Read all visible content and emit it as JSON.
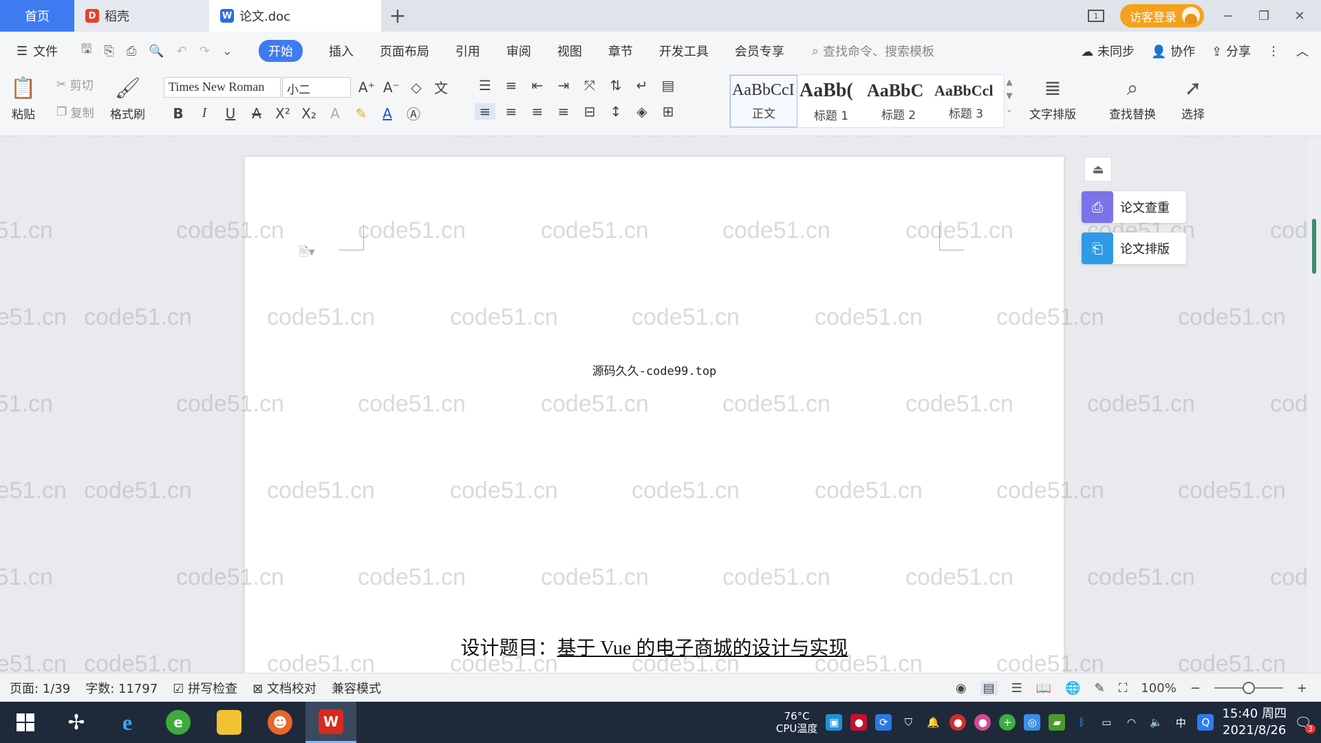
{
  "tabs": {
    "home": "首页",
    "docer": "稻壳",
    "doc": "论文.doc",
    "add": "+"
  },
  "titlebar": {
    "login": "访客登录",
    "win_box": "1",
    "minimize": "−",
    "restore": "❐",
    "close": "✕"
  },
  "menu": {
    "file": "文件",
    "items": [
      "开始",
      "插入",
      "页面布局",
      "引用",
      "审阅",
      "视图",
      "章节",
      "开发工具",
      "会员专享"
    ],
    "search": "查找命令、搜索模板",
    "unsync": "未同步",
    "collab": "协作",
    "share": "分享"
  },
  "ribbon": {
    "paste": "粘贴",
    "cut": "剪切",
    "copy": "复制",
    "format_painter": "格式刷",
    "font_name": "Times New Roman",
    "font_size": "小二",
    "styles": [
      {
        "sample": "AaBbCcI",
        "name": "正文"
      },
      {
        "sample": "AaBb(",
        "name": "标题 1"
      },
      {
        "sample": "AaBbC",
        "name": "标题 2"
      },
      {
        "sample": "AaBbCcl",
        "name": "标题 3"
      }
    ],
    "text_layout": "文字排版",
    "find_replace": "查找替换",
    "select": "选择"
  },
  "document": {
    "source_tag": "源码久久-code99.top",
    "title_prefix": "设计题目：",
    "title_underlined": "基于 Vue 的电子商城的设计与实现"
  },
  "watermark_text": "code51.cn",
  "side_panel": {
    "check": "论文查重",
    "layout": "论文排版"
  },
  "status": {
    "page": "页面: 1/39",
    "words": "字数: 11797",
    "spell": "拼写检查",
    "proofread": "文档校对",
    "compat": "兼容模式",
    "zoom": "100%",
    "zoom_level": 0.5
  },
  "taskbar": {
    "cpu_temp": "76°C",
    "cpu_label": "CPU温度",
    "ime": "中",
    "time": "15:40 周四",
    "date": "2021/8/26",
    "notif_count": "3"
  },
  "colors": {
    "accent": "#3e7bf0",
    "login": "#f4a21d",
    "taskbar": "#1e2a3a"
  }
}
